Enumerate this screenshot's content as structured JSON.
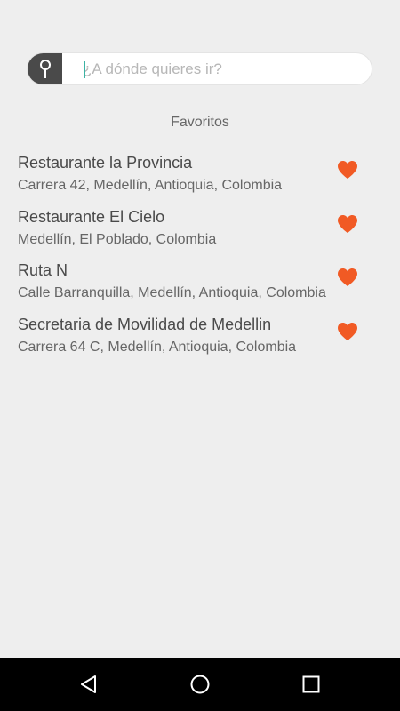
{
  "search": {
    "placeholder": "¿A dónde quieres ir?",
    "value": ""
  },
  "favorites": {
    "title": "Favoritos",
    "items": [
      {
        "name": "Restaurante la Provincia",
        "address": "Carrera 42, Medellín, Antioquia, Colombia"
      },
      {
        "name": "Restaurante El Cielo",
        "address": "Medellín, El Poblado, Colombia"
      },
      {
        "name": "Ruta N",
        "address": "Calle Barranquilla, Medellín, Antioquia, Colombia"
      },
      {
        "name": "Secretaria de Movilidad de Medellin",
        "address": "Carrera 64 C, Medellín, Antioquia, Colombia"
      }
    ]
  },
  "icons": {
    "search_pin": "map-pin-icon",
    "favorite": "heart-icon",
    "nav_back": "back-triangle-icon",
    "nav_home": "home-circle-icon",
    "nav_recent": "recent-apps-square-icon"
  },
  "colors": {
    "background": "#eeeeee",
    "heart": "#f15a24",
    "pin_box": "#4a4a4a",
    "caret": "#3bb3a4",
    "navbar": "#000000"
  }
}
